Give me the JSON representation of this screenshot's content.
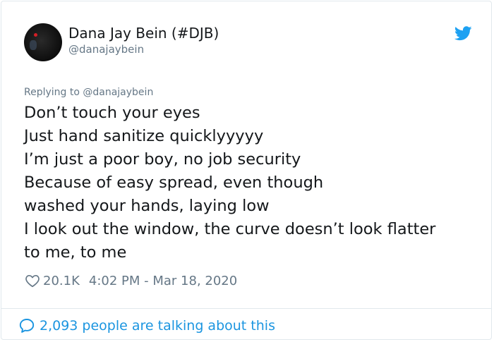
{
  "author": {
    "display_name": "Dana Jay Bein (#DJB)",
    "handle": "@danajaybein"
  },
  "reply": {
    "text": "Replying to @danajaybein"
  },
  "tweet": {
    "lines": [
      "Don’t touch your eyes",
      "Just hand sanitize quicklyyyyy",
      "I’m just a poor boy, no job security",
      "Because of easy spread, even though",
      "washed your hands, laying low",
      "I look out the window, the curve doesn’t look flatter",
      "to me, to me"
    ]
  },
  "meta": {
    "likes": "20.1K",
    "timestamp": "4:02 PM - Mar 18, 2020"
  },
  "footer": {
    "talking": "2,093 people are talking about this"
  },
  "colors": {
    "twitter_blue": "#1da1f2",
    "link_blue": "#1b95e0",
    "secondary_text": "#657786",
    "primary_text": "#14171a",
    "border": "#e1e8ed"
  },
  "icons": {
    "logo": "twitter-bird-icon",
    "like": "heart-icon",
    "conversation": "speech-bubble-icon"
  }
}
